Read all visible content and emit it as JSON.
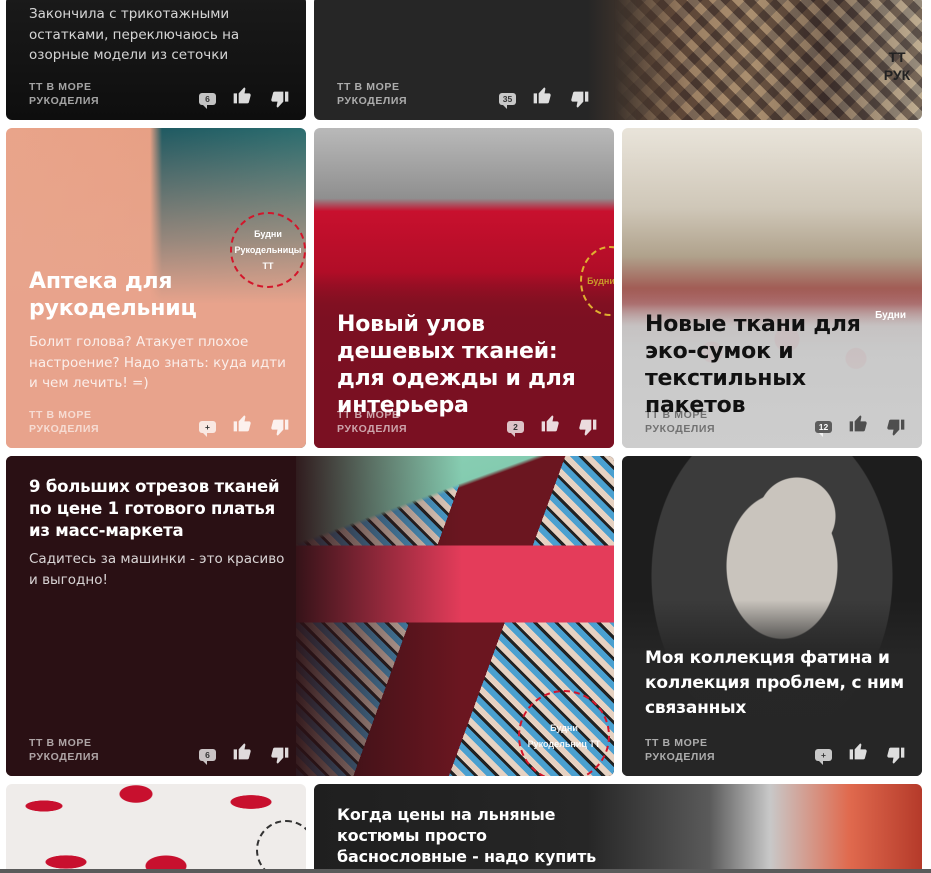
{
  "colors": {
    "card1": "#141414",
    "card2": "#232323",
    "card3": "#e7a58d",
    "card4": "#7a1022",
    "card5": "#c8c8c8",
    "card6": "#2a1014",
    "card7": "#262626",
    "stamp": "#d3162b"
  },
  "cards": [
    {
      "id": "c1",
      "desc": "Закончила с трикотажными остатками, переключаюсь на озорные модели из сеточки",
      "source": "ТТ В МОРЕ РУКОДЕЛИЯ",
      "comments": "6"
    },
    {
      "id": "c2",
      "stamp": "ТТ РУК",
      "source": "ТТ В МОРЕ РУКОДЕЛИЯ",
      "comments": "35"
    },
    {
      "id": "c3",
      "title": "Аптека для рукодельниц",
      "desc": "Болит голова? Атакует плохое настроение? Надо знать: куда идти и чем лечить! =)",
      "stamp": "Будни Рукодельницы ТТ",
      "source": "ТТ В МОРЕ РУКОДЕЛИЯ",
      "comments": "+"
    },
    {
      "id": "c4",
      "title": "Новый улов дешевых тканей: для одежды и для интерьера",
      "stamp": "Будни Рук",
      "source": "ТТ В МОРЕ РУКОДЕЛИЯ",
      "comments": "2"
    },
    {
      "id": "c5",
      "title": "Новые ткани для эко-сумок и текстильных пакетов",
      "stamp": "Будни",
      "source": "ТТ В МОРЕ РУКОДЕЛИЯ",
      "comments": "12"
    },
    {
      "id": "c6",
      "title": "9 больших отрезов тканей по цене 1 готового платья из масс-маркета",
      "desc": "Садитесь за машинки - это красиво и выгодно!",
      "stamp": "Будни Рукодельниц ТТ",
      "source": "ТТ В МОРЕ РУКОДЕЛИЯ",
      "comments": "6"
    },
    {
      "id": "c7",
      "title": "Моя коллекция фатина и коллекция проблем, с ним связанных",
      "source": "ТТ В МОРЕ РУКОДЕЛИЯ",
      "comments": "+"
    },
    {
      "id": "c8"
    },
    {
      "id": "c9",
      "title": "Когда цены на льняные костюмы просто баснословные - надо купить"
    }
  ]
}
